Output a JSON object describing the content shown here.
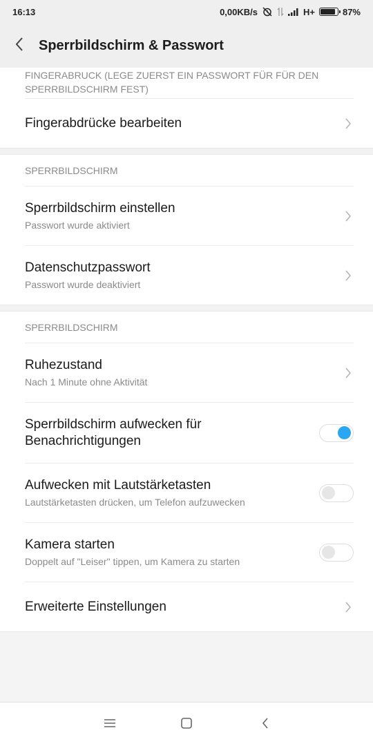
{
  "status_bar": {
    "time": "16:13",
    "net_speed": "0,00KB/s",
    "network_type": "H+",
    "battery_percent": "87%",
    "battery_level": 0.87,
    "icons": [
      "alarm-off-icon",
      "data-transfer-icon",
      "signal-icon",
      "battery-icon"
    ]
  },
  "header": {
    "title": "Sperrbildschirm & Passwort",
    "back_icon": "chevron-left-icon"
  },
  "sections": {
    "fingerprint": {
      "header": "FINGERABRUCK (LEGE ZUERST EIN PASSWORT FÜR FÜR DEN SPERRBILDSCHIRM FEST)",
      "items": [
        {
          "title": "Fingerabdrücke bearbeiten"
        }
      ]
    },
    "lockscreen": {
      "header": "SPERRBILDSCHIRM",
      "items": [
        {
          "title": "Sperrbildschirm einstellen",
          "subtitle": "Passwort wurde aktiviert"
        },
        {
          "title": "Datenschutzpasswort",
          "subtitle": "Passwort wurde deaktiviert"
        }
      ]
    },
    "lockscreen2": {
      "header": "SPERRBILDSCHIRM",
      "items": [
        {
          "title": "Ruhezustand",
          "subtitle": "Nach 1 Minute ohne Aktivität"
        },
        {
          "title_line1": "Sperrbildschirm aufwecken für",
          "title_line2": "Benachrichtigungen",
          "toggle_on": true
        },
        {
          "title": "Aufwecken mit Lautstärketasten",
          "subtitle": "Lautstärketasten drücken, um Telefon aufzuwecken",
          "toggle_on": false
        },
        {
          "title": "Kamera starten",
          "subtitle": "Doppelt auf \"Leiser\" tippen, um Kamera zu starten",
          "toggle_on": false
        },
        {
          "title": "Erweiterte Einstellungen"
        }
      ]
    }
  },
  "nav_bar": {
    "icons": [
      "menu-icon",
      "home-icon",
      "back-icon"
    ]
  },
  "colors": {
    "accent": "#2aa6f2",
    "background": "#f4f4f4",
    "card": "#ffffff",
    "secondary_text": "#8a8a8a"
  }
}
